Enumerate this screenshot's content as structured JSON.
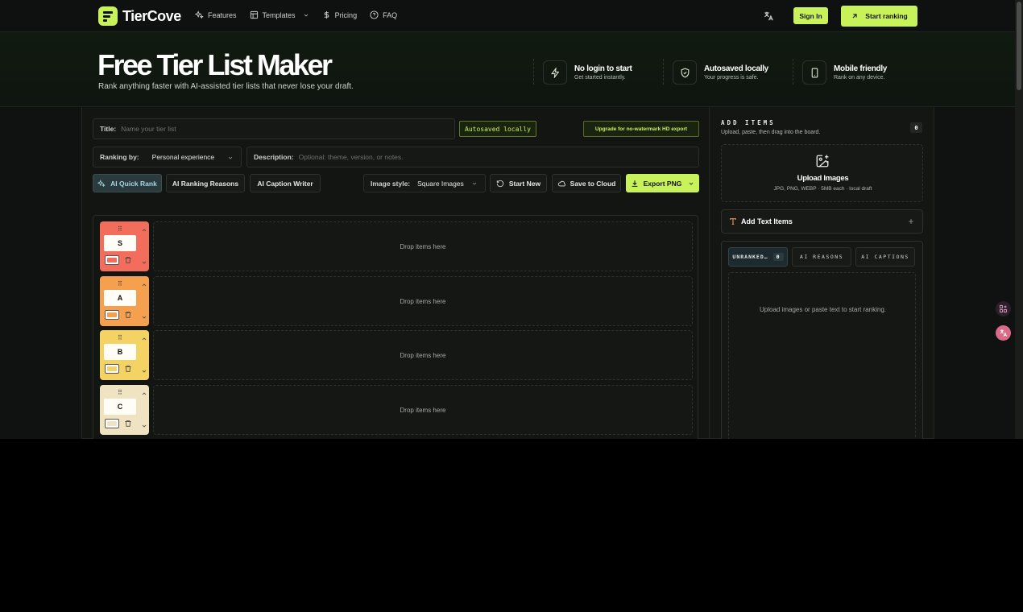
{
  "nav": {
    "brand": "TierCove",
    "links": [
      {
        "label": "Features",
        "icon": "sparkles-icon"
      },
      {
        "label": "Templates",
        "icon": "template-icon"
      },
      {
        "label": "Pricing",
        "icon": "dollar-icon"
      },
      {
        "label": "FAQ",
        "icon": "help-circle-icon"
      }
    ],
    "sign_in": "Sign In",
    "start": "Start ranking"
  },
  "hero": {
    "title": "Free Tier List Maker",
    "subtitle": "Rank anything faster with AI-assisted tier lists that never lose your draft.",
    "features": [
      {
        "title": "No login to start",
        "desc": "Get started instantly."
      },
      {
        "title": "Autosaved locally",
        "desc": "Your progress is safe."
      },
      {
        "title": "Mobile friendly",
        "desc": "Rank on any device."
      }
    ]
  },
  "editor": {
    "title_label": "Title:",
    "title_placeholder": "Name your tier list",
    "autosaved": "Autosaved locally",
    "upgrade": "Upgrade for no-watermark HD export",
    "ranking_label": "Ranking by:",
    "ranking_value": "Personal experience",
    "desc_label": "Description:",
    "desc_placeholder": "Optional: theme, version, or notes.",
    "ai_quick": "AI Quick Rank",
    "ai_reasons": "AI Ranking Reasons",
    "ai_caption": "AI Caption Writer",
    "image_style_label": "Image style:",
    "image_style_value": "Square Images",
    "start_new": "Start New",
    "save_cloud": "Save to Cloud",
    "export": "Export PNG"
  },
  "tiers": [
    {
      "label": "S",
      "color": "#f26d5b",
      "drop": "Drop items here"
    },
    {
      "label": "A",
      "color": "#f5a04f",
      "drop": "Drop items here"
    },
    {
      "label": "B",
      "color": "#f4d364",
      "drop": "Drop items here"
    },
    {
      "label": "C",
      "color": "#efe3c2",
      "drop": "Drop items here"
    }
  ],
  "side": {
    "title": "ADD ITEMS",
    "subtitle": "Upload, paste, then drag into the board.",
    "count": "0",
    "upload_title": "Upload Images",
    "upload_desc": "JPG, PNG, WEBP · 5MB each · local draft",
    "add_text": "Add Text Items",
    "tab_unranked": "UNRANKED…",
    "tab_unranked_count": "0",
    "tab_reasons": "AI REASONS",
    "tab_captions": "AI CAPTIONS",
    "empty": "Upload images or paste text to start ranking."
  },
  "colors": {
    "accent": "#c8f25a",
    "background": "#0f1210"
  }
}
